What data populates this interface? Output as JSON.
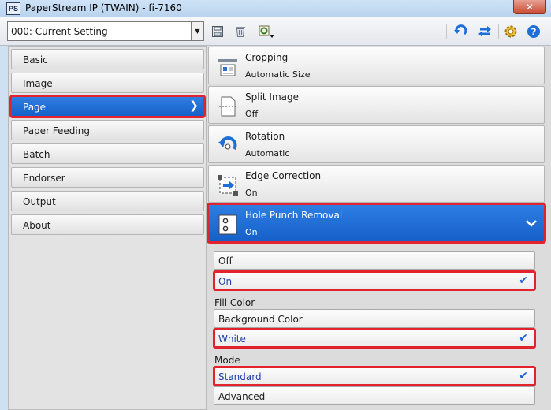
{
  "window": {
    "app_icon": "PS",
    "title": "PaperStream IP (TWAIN) - fi-7160",
    "close_glyph": "✕"
  },
  "toolbar": {
    "setting_value": "000: Current Setting",
    "icons": [
      "save-icon",
      "delete-icon",
      "settings-export-icon",
      "reset-icon",
      "swap-icon",
      "gear-icon",
      "help-icon"
    ]
  },
  "sidebar": {
    "items": [
      {
        "label": "Basic"
      },
      {
        "label": "Image"
      },
      {
        "label": "Page"
      },
      {
        "label": "Paper Feeding"
      },
      {
        "label": "Batch"
      },
      {
        "label": "Endorser"
      },
      {
        "label": "Output"
      },
      {
        "label": "About"
      }
    ],
    "active_index": 2
  },
  "categories": [
    {
      "name": "Cropping",
      "value": "Automatic Size",
      "icon": "cropping-icon"
    },
    {
      "name": "Split Image",
      "value": "Off",
      "icon": "split-image-icon"
    },
    {
      "name": "Rotation",
      "value": "Automatic",
      "icon": "rotation-icon"
    },
    {
      "name": "Edge Correction",
      "value": "On",
      "icon": "edge-correction-icon"
    },
    {
      "name": "Hole Punch Removal",
      "value": "On",
      "icon": "hole-punch-icon"
    }
  ],
  "hole_punch": {
    "options": [
      {
        "label": "Off"
      },
      {
        "label": "On"
      }
    ],
    "selected_index": 1,
    "fill_color": {
      "label": "Fill Color",
      "options": [
        {
          "label": "Background Color"
        },
        {
          "label": "White"
        }
      ],
      "selected_index": 1
    },
    "mode": {
      "label": "Mode",
      "options": [
        {
          "label": "Standard"
        },
        {
          "label": "Advanced"
        }
      ],
      "selected_index": 0
    }
  },
  "colors": {
    "accent": "#1f6fd8",
    "highlight_outline": "#e2232e",
    "selected_text": "#1f3fb0"
  }
}
